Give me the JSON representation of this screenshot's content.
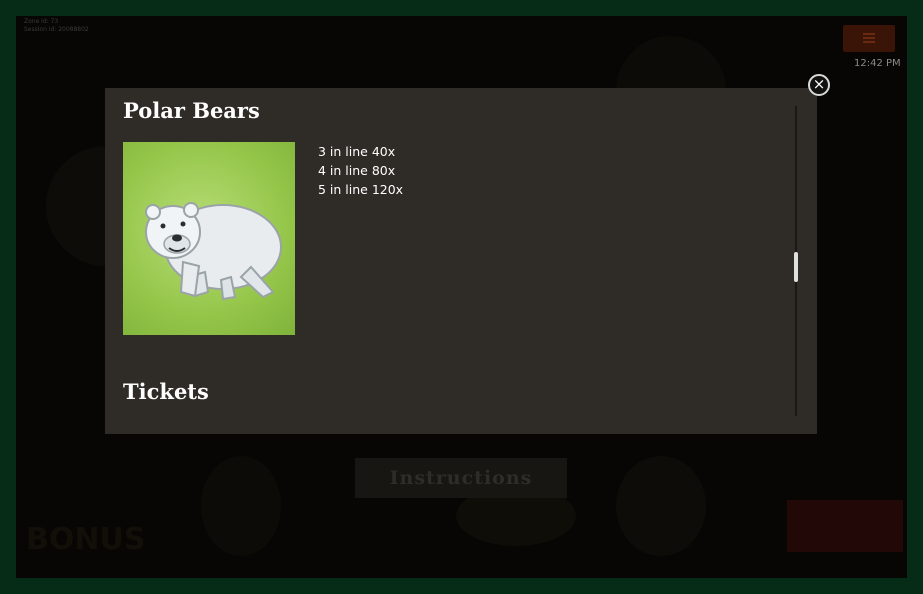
{
  "game": {
    "info_lines": [
      "Zone id: 73",
      "Session id: 20088802"
    ],
    "clock": "12:42 PM",
    "instructions_label": "Instructions",
    "bonus_label": "BONUS"
  },
  "modal": {
    "section_title": "Polar Bears",
    "symbol_icon": "polar-bear",
    "payouts": [
      "3 in line 40x",
      "4 in line 80x",
      "5 in line 120x"
    ],
    "next_section_title": "Tickets",
    "close_glyph": "×",
    "scroll_position": 0.52
  },
  "colors": {
    "modal_bg": "#2f2b27",
    "frame": "#062b17",
    "symbol_bg": "#95c64a"
  }
}
